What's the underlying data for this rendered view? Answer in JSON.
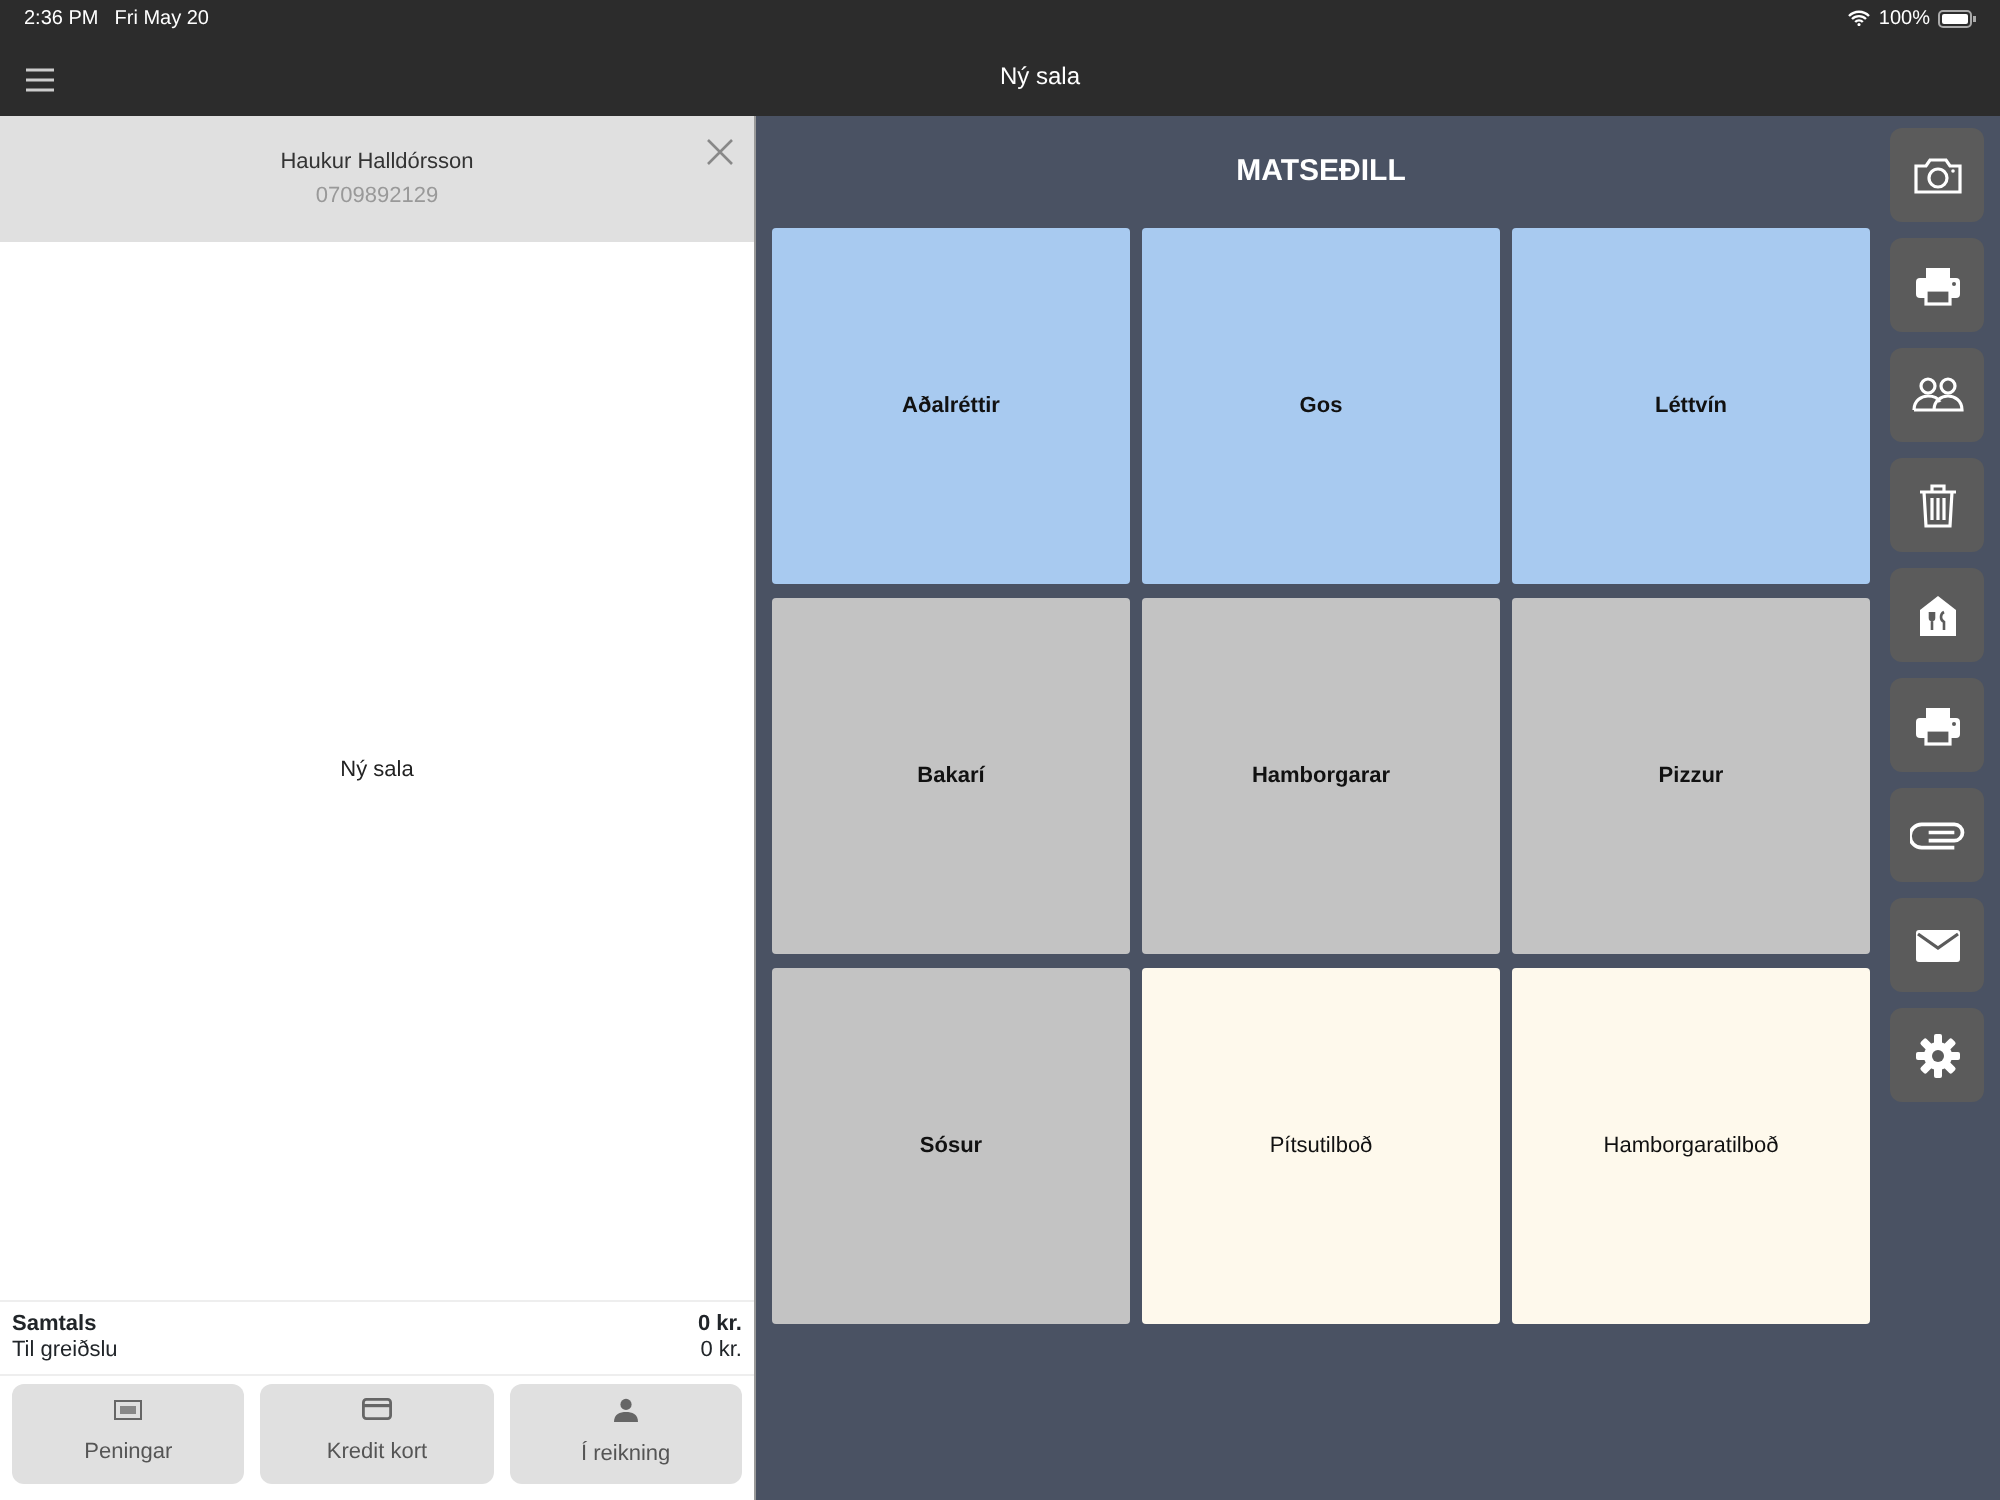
{
  "status_bar": {
    "time": "2:36 PM",
    "date": "Fri May 20",
    "battery": "100%"
  },
  "nav_bar": {
    "title": "Ný sala"
  },
  "customer": {
    "name": "Haukur Halldórsson",
    "phone": "0709892129"
  },
  "order": {
    "empty_text": "Ný sala"
  },
  "totals": [
    {
      "label": "Samtals",
      "value": "0 kr.",
      "bold": true
    },
    {
      "label": "Til greiðslu",
      "value": "0 kr.",
      "bold": false
    }
  ],
  "payment_buttons": [
    {
      "kind": "cash",
      "label": "Peningar"
    },
    {
      "kind": "card",
      "label": "Kredit kort"
    },
    {
      "kind": "account",
      "label": "Í reikning"
    }
  ],
  "menu": {
    "title": "MATSEÐILL",
    "tiles": [
      {
        "label": "Aðalréttir",
        "kind": "category",
        "color": "#a8caf0"
      },
      {
        "label": "Gos",
        "kind": "category",
        "color": "#a8caf0"
      },
      {
        "label": "Léttvín",
        "kind": "category",
        "color": "#a8caf0"
      },
      {
        "label": "Bakarí",
        "kind": "category",
        "color": "#c3c3c3"
      },
      {
        "label": "Hamborgarar",
        "kind": "category",
        "color": "#c3c3c3"
      },
      {
        "label": "Pizzur",
        "kind": "category",
        "color": "#c3c3c3"
      },
      {
        "label": "Sósur",
        "kind": "category",
        "color": "#c3c3c3"
      },
      {
        "label": "Pítsutilboð",
        "kind": "offer",
        "color": "#fef9ec"
      },
      {
        "label": "Hamborgaratilboð",
        "kind": "offer",
        "color": "#fef9ec"
      }
    ]
  },
  "toolbar": [
    {
      "kind": "camera"
    },
    {
      "kind": "printer"
    },
    {
      "kind": "people"
    },
    {
      "kind": "trash"
    },
    {
      "kind": "restaurant"
    },
    {
      "kind": "printer"
    },
    {
      "kind": "paperclip"
    },
    {
      "kind": "mail"
    },
    {
      "kind": "settings"
    }
  ]
}
